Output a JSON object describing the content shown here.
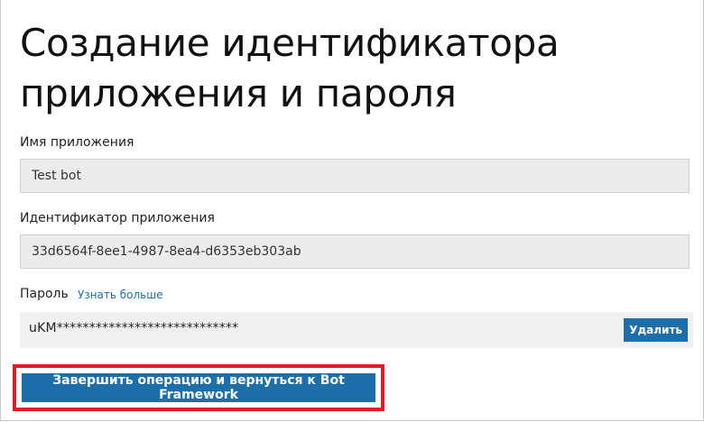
{
  "page": {
    "title": "Создание идентификатора приложения и пароля"
  },
  "app_name": {
    "label": "Имя приложения",
    "value": "Test bot"
  },
  "app_id": {
    "label": "Идентификатор приложения",
    "value": "33d6564f-8ee1-4987-8ea4-d6353eb303ab"
  },
  "password": {
    "label": "Пароль",
    "learn_more": "Узнать больше",
    "value": "uKM****************************",
    "delete_label": "Удалить"
  },
  "actions": {
    "finish_label": "Завершить операцию и вернуться к Bot Framework"
  },
  "colors": {
    "accent": "#1c6fa8",
    "highlight_border": "#e21b26",
    "link": "#1a6fb0"
  }
}
